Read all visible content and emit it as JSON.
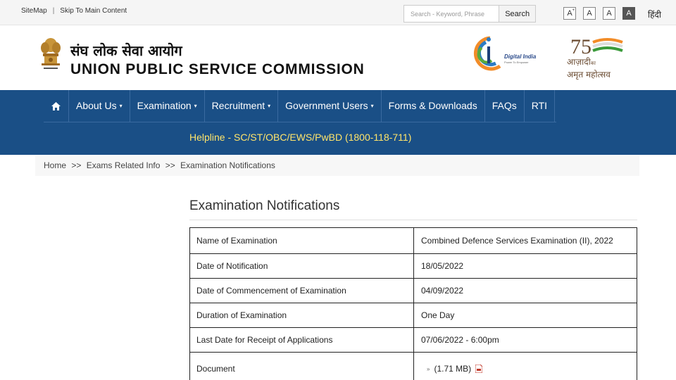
{
  "topbar": {
    "sitemap": "SiteMap",
    "separator": "|",
    "skip": "Skip To Main Content",
    "search_placeholder": "Search - Keyword, Phrase",
    "search_button": "Search",
    "font_sizes": [
      "A",
      "A",
      "A",
      "A"
    ],
    "font_plus_sup": "+",
    "language": "हिंदी"
  },
  "header": {
    "title_hindi": "संघ लोक सेवा आयोग",
    "title_english": "UNION PUBLIC SERVICE COMMISSION",
    "digital_india": "Digital India",
    "digital_india_sub": "Power To Empower",
    "azadi_line1": "आज़ादी",
    "azadi_ka": "का",
    "azadi_line2": "अमृत महोत्सव",
    "azadi_75": "75"
  },
  "nav": {
    "home_icon": "home-icon",
    "items": [
      {
        "label": "About Us",
        "has_caret": true
      },
      {
        "label": "Examination",
        "has_caret": true
      },
      {
        "label": "Recruitment",
        "has_caret": true
      },
      {
        "label": "Government Users",
        "has_caret": true
      },
      {
        "label": "Forms & Downloads",
        "has_caret": false
      },
      {
        "label": "FAQs",
        "has_caret": false
      },
      {
        "label": "RTI",
        "has_caret": false
      }
    ],
    "caret": "▾",
    "helpline": "Helpline - SC/ST/OBC/EWS/PwBD (1800-118-711)"
  },
  "breadcrumb": {
    "home": "Home",
    "sep": ">>",
    "level1": "Exams Related Info",
    "level2": "Examination Notifications"
  },
  "content": {
    "page_title": "Examination Notifications",
    "table": {
      "header": {
        "label": "Name of Examination",
        "value": "Combined Defence Services Examination (II), 2022"
      },
      "rows": [
        {
          "label": "Date of Notification",
          "value": "18/05/2022"
        },
        {
          "label": "Date of Commencement of Examination",
          "value": "04/09/2022"
        },
        {
          "label": "Duration of Examination",
          "value": "One Day"
        },
        {
          "label": "Last Date for Receipt of Applications",
          "value": "07/06/2022 - 6:00pm"
        }
      ],
      "document": {
        "label": "Document",
        "bullet": "»",
        "size": "(1.71 MB)",
        "icon": "pdf-icon"
      }
    }
  },
  "colors": {
    "nav_blue": "#1a4f86",
    "helpline_yellow": "#ffe46b",
    "digital_india_blue": "#2a4a8a"
  }
}
